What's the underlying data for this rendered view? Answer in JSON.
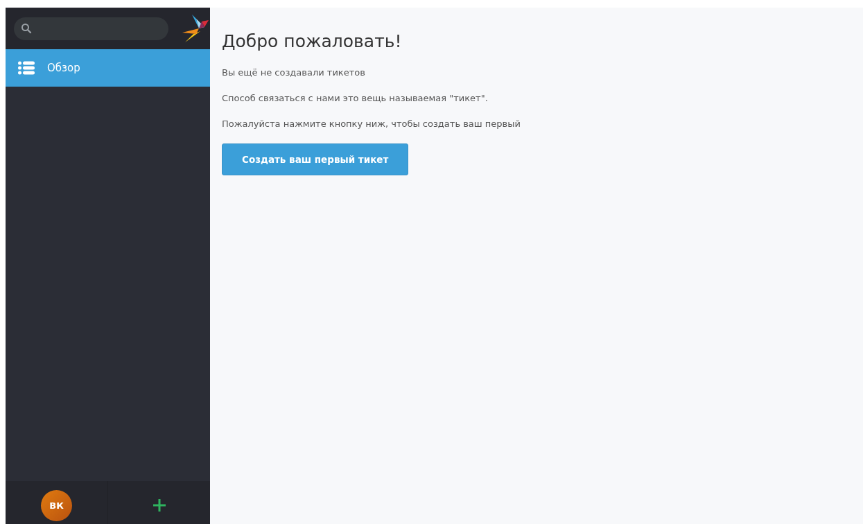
{
  "sidebar": {
    "items": [
      {
        "label": "Обзор",
        "selected": true
      }
    ],
    "user": {
      "initials": "ВК"
    }
  },
  "main": {
    "title": "Добро пожаловать!",
    "paragraphs": [
      "Вы ещё не создавали тикетов",
      "Способ связаться с нами это вещь называемая \"тикет\".",
      "Пожалуйста нажмите кнопку ниж, чтобы создать ваш первый"
    ],
    "button": "Создать ваш первый тикет"
  }
}
